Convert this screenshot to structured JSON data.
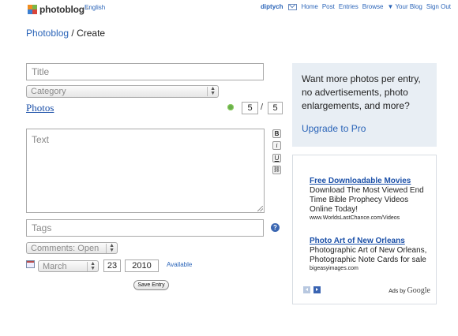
{
  "header": {
    "logo_text": "photoblog",
    "logo_tm": "™",
    "language": "English",
    "username": "diptych",
    "nav": [
      "Home",
      "Post",
      "Entries",
      "Browse",
      "▼ Your Blog",
      "Sign Out"
    ]
  },
  "breadcrumb": {
    "parent": "Photoblog",
    "separator": " / ",
    "current": "Create"
  },
  "form": {
    "title_placeholder": "Title",
    "category_placeholder": "Category",
    "photos_label": "Photos",
    "photo_count": "5",
    "photo_count_separator": "/",
    "photo_max": "5",
    "text_placeholder": "Text",
    "format_buttons": {
      "bold": "B",
      "italic": "i",
      "underline": "U",
      "link": "⛓"
    },
    "tags_placeholder": "Tags",
    "help": "?",
    "comments_value": "Comments: Open",
    "date": {
      "month": "March",
      "day": "23",
      "year": "2010"
    },
    "available_label": "Available",
    "save_label": "Save Entry"
  },
  "promo": {
    "text": "Want more photos per entry, no advertisements, photo enlargements, and more?",
    "link": "Upgrade to Pro"
  },
  "ads": {
    "items": [
      {
        "title": "Free Downloadable Movies",
        "body": "Download The Most Viewed End Time Bible Prophecy Videos Online Today!",
        "url": "www.WorldsLastChance.com/Videos"
      },
      {
        "title": "Photo Art of New Orleans",
        "body": "Photographic Art of New Orleans, Photographic Note Cards for sale",
        "url": "bigeasyimages.com"
      }
    ],
    "ads_by_prefix": "Ads by",
    "ads_by_brand": "Google"
  },
  "colors": {
    "link": "#2a64b8",
    "promo_bg": "#e8eef4",
    "logo_orange": "#f08c1e",
    "logo_green": "#7ab648",
    "logo_blue": "#3b7fd1",
    "logo_red": "#d9453b"
  }
}
